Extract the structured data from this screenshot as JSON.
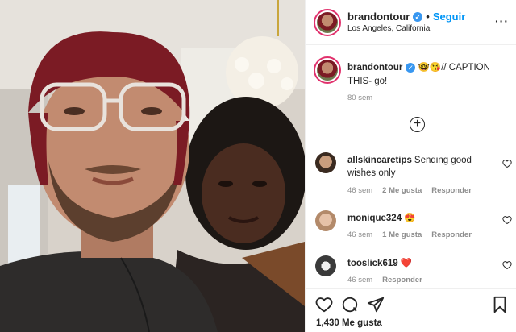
{
  "post": {
    "username": "brandontour",
    "verified_mark": "✓",
    "separator": "•",
    "follow_label": "Seguir",
    "location": "Los Angeles, California",
    "more_label": "···"
  },
  "caption": {
    "username": "brandontour",
    "verified_mark": "✓",
    "text": "🤓😘// CAPTION THIS- go!",
    "time": "80 sem"
  },
  "load_more_label": "+",
  "comments": [
    {
      "username": "allskincaretips",
      "text": "Sending good wishes only",
      "time": "46 sem",
      "likes": "2 Me gusta",
      "reply": "Responder"
    },
    {
      "username": "monique324",
      "text": "😍",
      "time": "46 sem",
      "likes": "1 Me gusta",
      "reply": "Responder"
    },
    {
      "username": "tooslick619",
      "text": "❤️",
      "time": "46 sem",
      "likes": "",
      "reply": "Responder"
    }
  ],
  "actions": {
    "like_icon": "heart-icon",
    "comment_icon": "comment-icon",
    "share_icon": "share-icon",
    "save_icon": "bookmark-icon"
  },
  "like_count": "1,430 Me gusta",
  "colors": {
    "accent": "#0095f6",
    "verified": "#3897f0",
    "muted": "#8e8e8e",
    "text": "#262626"
  }
}
